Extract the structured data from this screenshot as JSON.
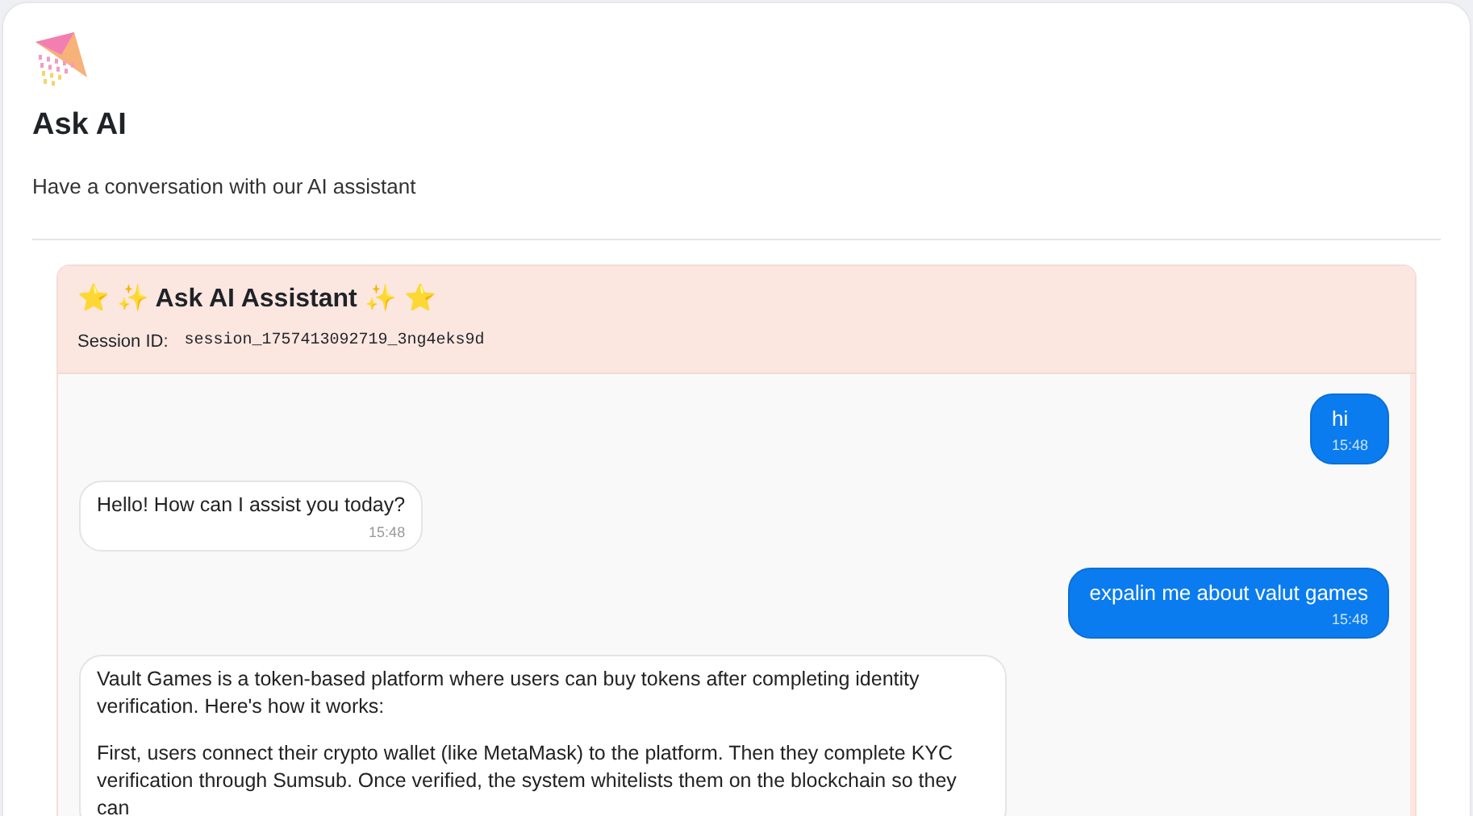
{
  "page": {
    "title": "Ask AI",
    "subtitle": "Have a conversation with our AI assistant"
  },
  "chat": {
    "title": "⭐ ✨ Ask AI Assistant ✨ ⭐",
    "session_label": "Session ID:",
    "session_id": "session_1757413092719_3ng4eks9d",
    "messages": [
      {
        "kind": "sent",
        "paragraphs": [
          "hi"
        ],
        "time": "15:48"
      },
      {
        "kind": "received",
        "paragraphs": [
          "Hello! How can I assist you today?"
        ],
        "time": "15:48"
      },
      {
        "kind": "sent",
        "paragraphs": [
          "expalin me about valut games"
        ],
        "time": "15:48"
      },
      {
        "kind": "received",
        "paragraphs": [
          "Vault Games is a token-based platform where users can buy tokens after completing identity verification. Here's how it works:",
          "First, users connect their crypto wallet (like MetaMask) to the platform. Then they complete KYC verification through Sumsub. Once verified, the system whitelists them on the blockchain so they can"
        ]
      }
    ]
  }
}
